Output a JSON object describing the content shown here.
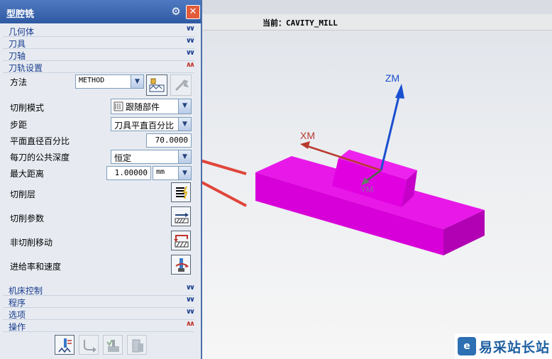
{
  "dialog": {
    "title": "型腔铣",
    "sections_top": [
      {
        "label": "几何体",
        "state": "collapsed"
      },
      {
        "label": "刀具",
        "state": "collapsed"
      },
      {
        "label": "刀轴",
        "state": "collapsed"
      },
      {
        "label": "刀轨设置",
        "state": "expanded"
      }
    ],
    "path_settings": {
      "method": {
        "label": "方法",
        "value": "METHOD"
      },
      "cut_pattern": {
        "label": "切削模式",
        "value": "跟随部件"
      },
      "stepover": {
        "label": "步距",
        "value": "刀具平直百分比"
      },
      "flat_diameter_percent": {
        "label": "平面直径百分比",
        "value": "70.0000"
      },
      "common_depth_per_cut": {
        "label": "每刀的公共深度",
        "value": "恒定"
      },
      "max_distance": {
        "label": "最大距离",
        "value": "1.00000",
        "unit": "mm"
      },
      "cut_levels": {
        "label": "切削层"
      },
      "cutting_parameters": {
        "label": "切削参数"
      },
      "non_cutting_moves": {
        "label": "非切削移动"
      },
      "feeds_speeds": {
        "label": "进给率和速度"
      }
    },
    "sections_bottom": [
      {
        "label": "机床控制",
        "state": "collapsed"
      },
      {
        "label": "程序",
        "state": "collapsed"
      },
      {
        "label": "选项",
        "state": "collapsed"
      },
      {
        "label": "操作",
        "state": "expanded"
      }
    ]
  },
  "viewport": {
    "current_label": "当前：CAVITY_MILL",
    "axes": {
      "zm": "ZM",
      "xm": "XM",
      "ym": "YM"
    },
    "part_color": "#f000f0",
    "watermark": "易采站长站"
  },
  "colors": {
    "accent": "#2f5aa3",
    "arrow_red": "#e0453a",
    "axis_blue": "#1a4fd0"
  }
}
